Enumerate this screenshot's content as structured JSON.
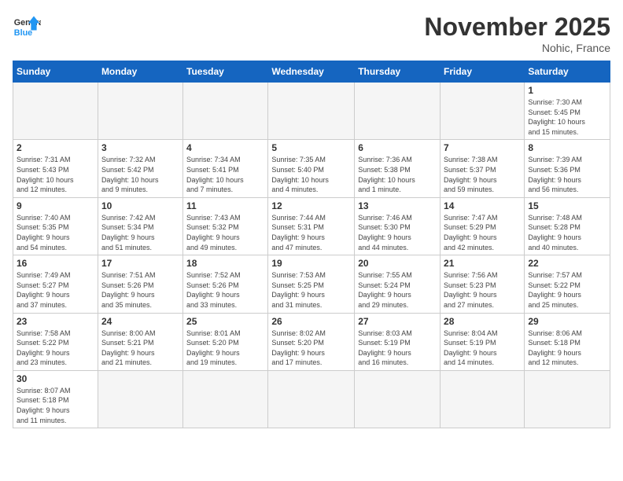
{
  "logo": {
    "text_general": "General",
    "text_blue": "Blue"
  },
  "title": "November 2025",
  "location": "Nohic, France",
  "days_of_week": [
    "Sunday",
    "Monday",
    "Tuesday",
    "Wednesday",
    "Thursday",
    "Friday",
    "Saturday"
  ],
  "weeks": [
    [
      {
        "day": "",
        "info": ""
      },
      {
        "day": "",
        "info": ""
      },
      {
        "day": "",
        "info": ""
      },
      {
        "day": "",
        "info": ""
      },
      {
        "day": "",
        "info": ""
      },
      {
        "day": "",
        "info": ""
      },
      {
        "day": "1",
        "info": "Sunrise: 7:30 AM\nSunset: 5:45 PM\nDaylight: 10 hours\nand 15 minutes."
      }
    ],
    [
      {
        "day": "2",
        "info": "Sunrise: 7:31 AM\nSunset: 5:43 PM\nDaylight: 10 hours\nand 12 minutes."
      },
      {
        "day": "3",
        "info": "Sunrise: 7:32 AM\nSunset: 5:42 PM\nDaylight: 10 hours\nand 9 minutes."
      },
      {
        "day": "4",
        "info": "Sunrise: 7:34 AM\nSunset: 5:41 PM\nDaylight: 10 hours\nand 7 minutes."
      },
      {
        "day": "5",
        "info": "Sunrise: 7:35 AM\nSunset: 5:40 PM\nDaylight: 10 hours\nand 4 minutes."
      },
      {
        "day": "6",
        "info": "Sunrise: 7:36 AM\nSunset: 5:38 PM\nDaylight: 10 hours\nand 1 minute."
      },
      {
        "day": "7",
        "info": "Sunrise: 7:38 AM\nSunset: 5:37 PM\nDaylight: 9 hours\nand 59 minutes."
      },
      {
        "day": "8",
        "info": "Sunrise: 7:39 AM\nSunset: 5:36 PM\nDaylight: 9 hours\nand 56 minutes."
      }
    ],
    [
      {
        "day": "9",
        "info": "Sunrise: 7:40 AM\nSunset: 5:35 PM\nDaylight: 9 hours\nand 54 minutes."
      },
      {
        "day": "10",
        "info": "Sunrise: 7:42 AM\nSunset: 5:34 PM\nDaylight: 9 hours\nand 51 minutes."
      },
      {
        "day": "11",
        "info": "Sunrise: 7:43 AM\nSunset: 5:32 PM\nDaylight: 9 hours\nand 49 minutes."
      },
      {
        "day": "12",
        "info": "Sunrise: 7:44 AM\nSunset: 5:31 PM\nDaylight: 9 hours\nand 47 minutes."
      },
      {
        "day": "13",
        "info": "Sunrise: 7:46 AM\nSunset: 5:30 PM\nDaylight: 9 hours\nand 44 minutes."
      },
      {
        "day": "14",
        "info": "Sunrise: 7:47 AM\nSunset: 5:29 PM\nDaylight: 9 hours\nand 42 minutes."
      },
      {
        "day": "15",
        "info": "Sunrise: 7:48 AM\nSunset: 5:28 PM\nDaylight: 9 hours\nand 40 minutes."
      }
    ],
    [
      {
        "day": "16",
        "info": "Sunrise: 7:49 AM\nSunset: 5:27 PM\nDaylight: 9 hours\nand 37 minutes."
      },
      {
        "day": "17",
        "info": "Sunrise: 7:51 AM\nSunset: 5:26 PM\nDaylight: 9 hours\nand 35 minutes."
      },
      {
        "day": "18",
        "info": "Sunrise: 7:52 AM\nSunset: 5:26 PM\nDaylight: 9 hours\nand 33 minutes."
      },
      {
        "day": "19",
        "info": "Sunrise: 7:53 AM\nSunset: 5:25 PM\nDaylight: 9 hours\nand 31 minutes."
      },
      {
        "day": "20",
        "info": "Sunrise: 7:55 AM\nSunset: 5:24 PM\nDaylight: 9 hours\nand 29 minutes."
      },
      {
        "day": "21",
        "info": "Sunrise: 7:56 AM\nSunset: 5:23 PM\nDaylight: 9 hours\nand 27 minutes."
      },
      {
        "day": "22",
        "info": "Sunrise: 7:57 AM\nSunset: 5:22 PM\nDaylight: 9 hours\nand 25 minutes."
      }
    ],
    [
      {
        "day": "23",
        "info": "Sunrise: 7:58 AM\nSunset: 5:22 PM\nDaylight: 9 hours\nand 23 minutes."
      },
      {
        "day": "24",
        "info": "Sunrise: 8:00 AM\nSunset: 5:21 PM\nDaylight: 9 hours\nand 21 minutes."
      },
      {
        "day": "25",
        "info": "Sunrise: 8:01 AM\nSunset: 5:20 PM\nDaylight: 9 hours\nand 19 minutes."
      },
      {
        "day": "26",
        "info": "Sunrise: 8:02 AM\nSunset: 5:20 PM\nDaylight: 9 hours\nand 17 minutes."
      },
      {
        "day": "27",
        "info": "Sunrise: 8:03 AM\nSunset: 5:19 PM\nDaylight: 9 hours\nand 16 minutes."
      },
      {
        "day": "28",
        "info": "Sunrise: 8:04 AM\nSunset: 5:19 PM\nDaylight: 9 hours\nand 14 minutes."
      },
      {
        "day": "29",
        "info": "Sunrise: 8:06 AM\nSunset: 5:18 PM\nDaylight: 9 hours\nand 12 minutes."
      }
    ],
    [
      {
        "day": "30",
        "info": "Sunrise: 8:07 AM\nSunset: 5:18 PM\nDaylight: 9 hours\nand 11 minutes."
      },
      {
        "day": "",
        "info": ""
      },
      {
        "day": "",
        "info": ""
      },
      {
        "day": "",
        "info": ""
      },
      {
        "day": "",
        "info": ""
      },
      {
        "day": "",
        "info": ""
      },
      {
        "day": "",
        "info": ""
      }
    ]
  ]
}
